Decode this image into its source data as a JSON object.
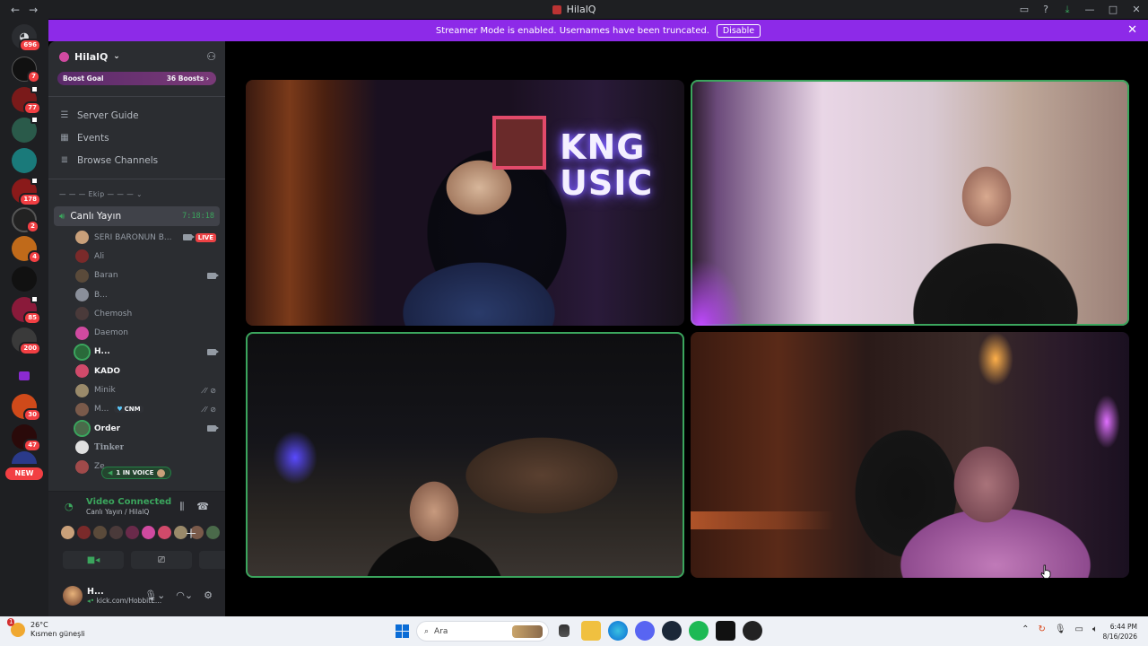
{
  "window": {
    "title": "HilalQ",
    "back": "←",
    "forward": "→"
  },
  "rail": {
    "home_badge": "696",
    "badges": [
      "7",
      "77",
      "178",
      "2",
      "4",
      "85",
      "200",
      "30",
      "47"
    ],
    "new_label": "NEW"
  },
  "banner": {
    "text": "Streamer Mode is enabled. Usernames have been truncated.",
    "button": "Disable"
  },
  "server": {
    "name": "HilalQ",
    "boost_label": "Boost Goal",
    "boost_count": "36 Boosts"
  },
  "nav": [
    {
      "label": "Server Guide"
    },
    {
      "label": "Events"
    },
    {
      "label": "Browse Channels"
    }
  ],
  "category": "Ekip",
  "voice_channel": {
    "name": "Canlı Yayın",
    "time": "7:18:18"
  },
  "members": [
    {
      "name": "SERİ BARONUN B...",
      "bold": false,
      "live": "LIVE",
      "color": "#c9a07a"
    },
    {
      "name": "Ali",
      "bold": false,
      "color": "#7a2a2a"
    },
    {
      "name": "Baran",
      "bold": false,
      "color": "#5a4a3a"
    },
    {
      "name": "B...",
      "bold": false,
      "color": "#8a8f9a"
    },
    {
      "name": "Chemosh",
      "bold": false,
      "color": "#4a3a3a"
    },
    {
      "name": "Daemon",
      "bold": false,
      "color": "#d04aa0"
    },
    {
      "name": "H...",
      "bold": true,
      "color": "#2a6a3a"
    },
    {
      "name": "KADO",
      "bold": true,
      "color": "#d04a6a"
    },
    {
      "name": "Minik",
      "bold": false,
      "color": "#9a8a6a"
    },
    {
      "name": "M...",
      "bold": false,
      "tag": "CNM",
      "color": "#7a5a4a"
    },
    {
      "name": "Order",
      "bold": true,
      "color": "#4a6a4a"
    },
    {
      "name": "Tinker",
      "bold": false,
      "color": "#e0e0e0"
    },
    {
      "name": "Ze...",
      "bold": false,
      "color": "#a04a4a"
    }
  ],
  "in_voice": "1 IN VOICE",
  "voice_status": {
    "status": "Video Connected",
    "location": "Canlı Yayın / HilalQ"
  },
  "user": {
    "name": "H...",
    "status": "kick.com/HobbitE..."
  },
  "taskbar": {
    "temp": "26°C",
    "weather": "Kısmen güneşli",
    "weather_badge": "1",
    "search": "Ara",
    "time": "6:44 PM",
    "date": "8/16/2026"
  },
  "colors": {
    "banner": "#8d2ae8",
    "speaking": "#3ba55d",
    "live": "#ed4245"
  }
}
